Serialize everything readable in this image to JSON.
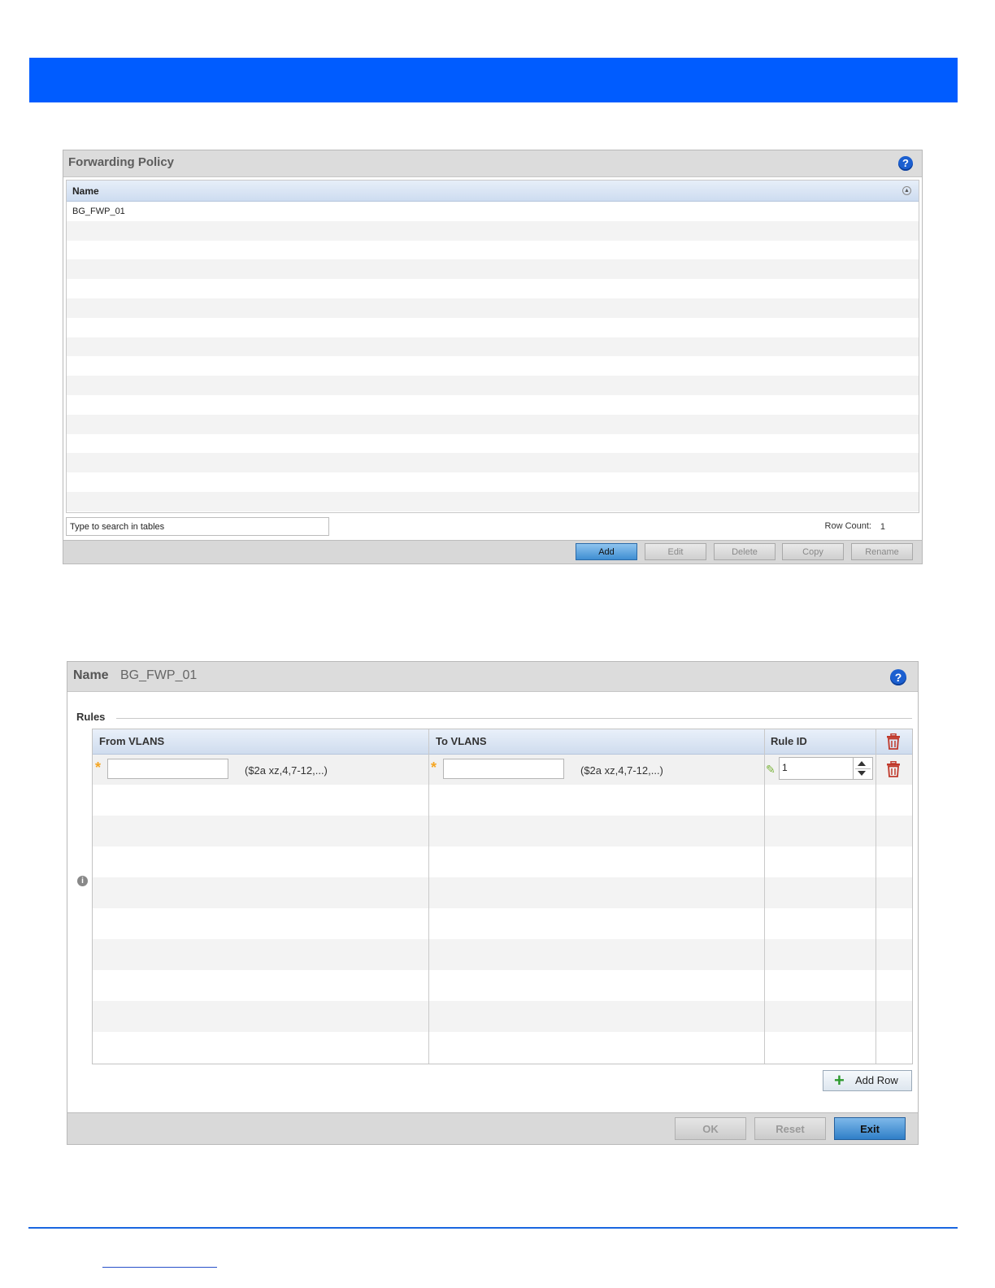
{
  "forwarding_policy": {
    "title": "Forwarding Policy",
    "table": {
      "column": "Name",
      "rows": [
        "BG_FWP_01"
      ]
    },
    "search_placeholder": "Type to search in tables",
    "row_count_label": "Row Count:",
    "row_count_value": "1",
    "buttons": {
      "add": "Add",
      "edit": "Edit",
      "delete": "Delete",
      "copy": "Copy",
      "rename": "Rename"
    }
  },
  "policy_editor": {
    "name_label": "Name",
    "name_value": "BG_FWP_01",
    "rules_title": "Rules",
    "columns": [
      "From VLANS",
      "To VLANS",
      "Rule ID"
    ],
    "row": {
      "from_hint": "($2a xz,4,7-12,...)",
      "to_hint": "($2a xz,4,7-12,...)",
      "rule_id": "1"
    },
    "add_row_label": "Add Row",
    "buttons": {
      "ok": "OK",
      "reset": "Reset",
      "exit": "Exit"
    }
  },
  "colors": {
    "banner": "#005cff",
    "accent_rule": "#1a66e0",
    "help_icon": "#1b5fd0",
    "delete_icon": "#c0392b",
    "required_star": "#f5a623"
  }
}
